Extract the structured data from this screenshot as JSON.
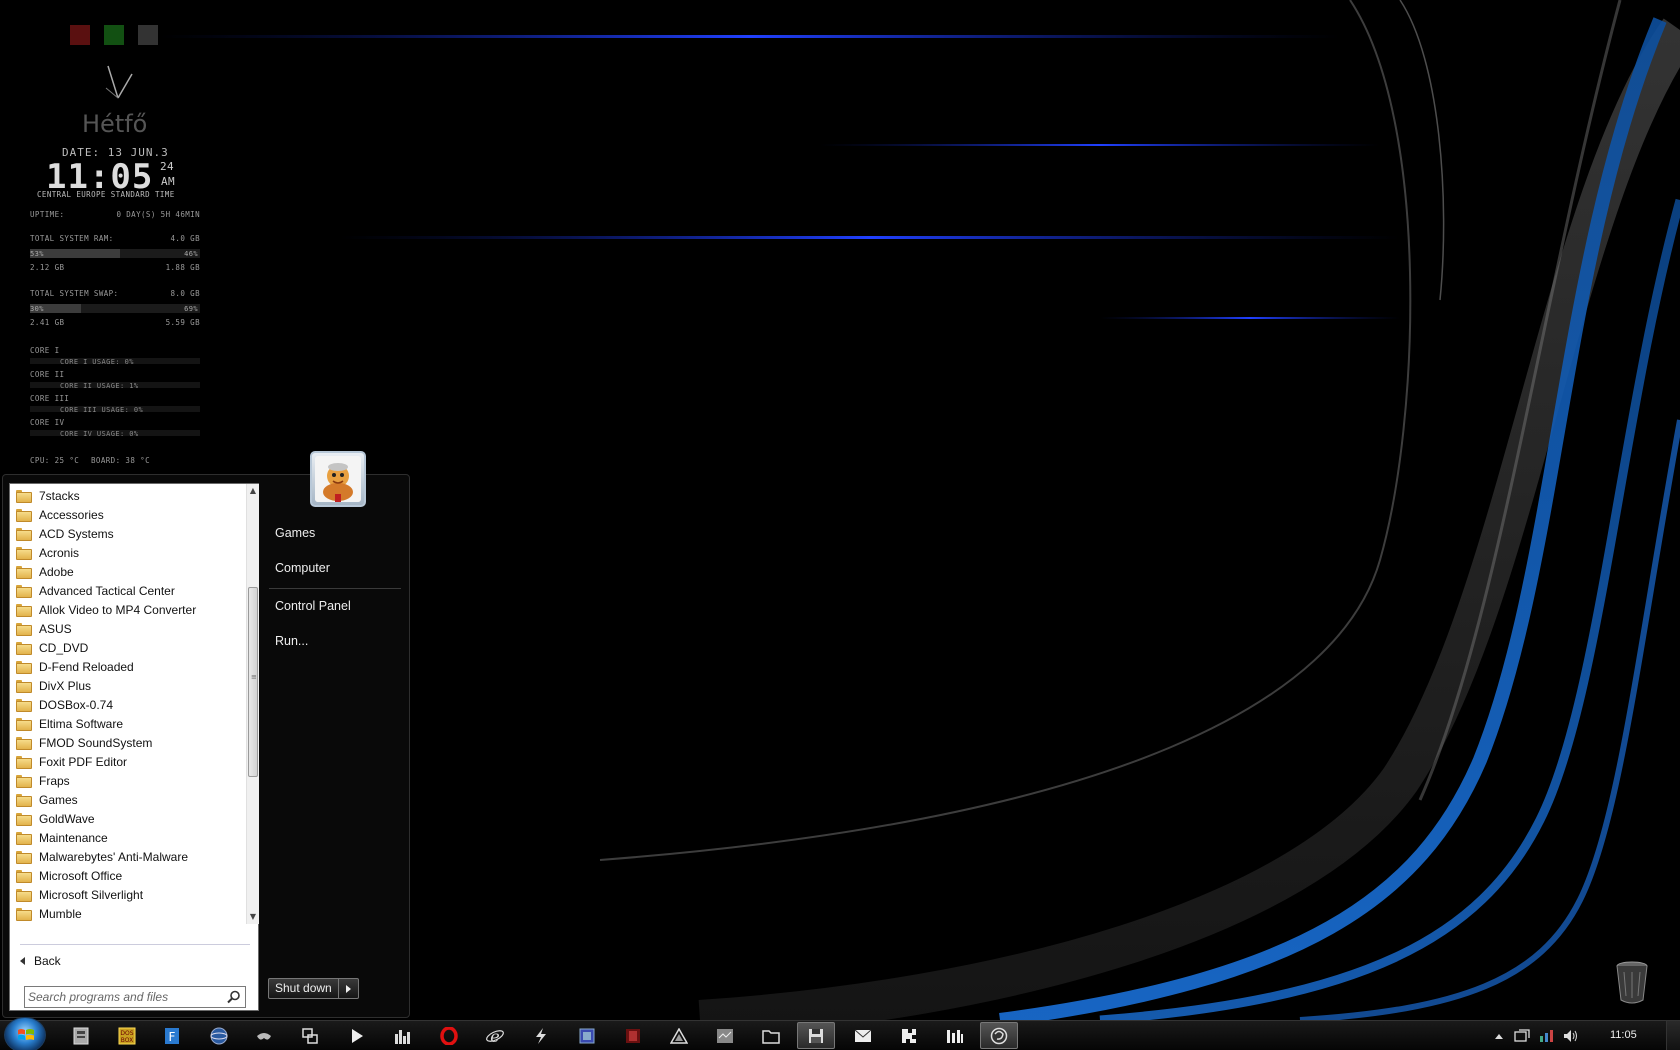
{
  "widget": {
    "dayname": "Hétfő",
    "date": "DATE: 13 JUN.3",
    "time_main": "11:05",
    "time_seconds": "24",
    "time_ampm": "AM",
    "timezone": "CENTRAL EUROPE STANDARD TIME",
    "uptime_label": "UPTIME:",
    "uptime_value": "0 DAY(S) 5H 46MIN",
    "ram": {
      "label": "TOTAL SYSTEM RAM:",
      "total": "4.0 GB",
      "used_pct": "53%",
      "free_pct": "46%",
      "used_fraction": 0.53,
      "used": "2.12 GB",
      "free": "1.88 GB"
    },
    "swap": {
      "label": "TOTAL SYSTEM SWAP:",
      "total": "8.0 GB",
      "used_pct": "30%",
      "free_pct": "69%",
      "used_fraction": 0.3,
      "used": "2.41 GB",
      "free": "5.59 GB"
    },
    "cores": [
      {
        "label": "CORE I",
        "usage": "CORE I USAGE: 0%",
        "fraction": 0.0
      },
      {
        "label": "CORE II",
        "usage": "CORE II USAGE: 1%",
        "fraction": 0.01
      },
      {
        "label": "CORE III",
        "usage": "CORE III USAGE: 0%",
        "fraction": 0.0
      },
      {
        "label": "CORE IV",
        "usage": "CORE IV USAGE: 0%",
        "fraction": 0.0
      }
    ],
    "cpu_temp": "CPU: 25 °C",
    "board_temp": "BOARD: 38 °C"
  },
  "start_menu": {
    "programs": [
      "7stacks",
      "Accessories",
      "ACD Systems",
      "Acronis",
      "Adobe",
      "Advanced Tactical Center",
      "Allok Video to MP4 Converter",
      "ASUS",
      "CD_DVD",
      "D-Fend Reloaded",
      "DivX Plus",
      "DOSBox-0.74",
      "Eltima Software",
      "FMOD SoundSystem",
      "Foxit PDF Editor",
      "Fraps",
      "Games",
      "GoldWave",
      "Maintenance",
      "Malwarebytes' Anti-Malware",
      "Microsoft Office",
      "Microsoft Silverlight",
      "Mumble"
    ],
    "back_label": "Back",
    "search_placeholder": "Search programs and files",
    "right_items": {
      "games": "Games",
      "computer": "Computer",
      "control_panel": "Control Panel",
      "run": "Run..."
    },
    "shutdown_label": "Shut down"
  },
  "taskbar": {
    "clock": "11:05",
    "icons": [
      "file-manager-icon",
      "dosbox-icon",
      "editor-icon",
      "network-icon",
      "gamepad-icon",
      "window-switch-icon",
      "play-icon",
      "equalizer-icon",
      "opera-icon",
      "internet-explorer-icon",
      "lightning-icon",
      "media-icon",
      "stack-icon",
      "triangle-app-icon",
      "monitor-app-icon",
      "folder-icon",
      "save-icon",
      "mail-icon",
      "puzzle-icon",
      "bars-icon",
      "firefox-icon"
    ]
  },
  "colors": {
    "accent_blue": "#1a3cff",
    "swirl_blue": "#1560c0",
    "menu_bg": "#0a0a0a"
  }
}
